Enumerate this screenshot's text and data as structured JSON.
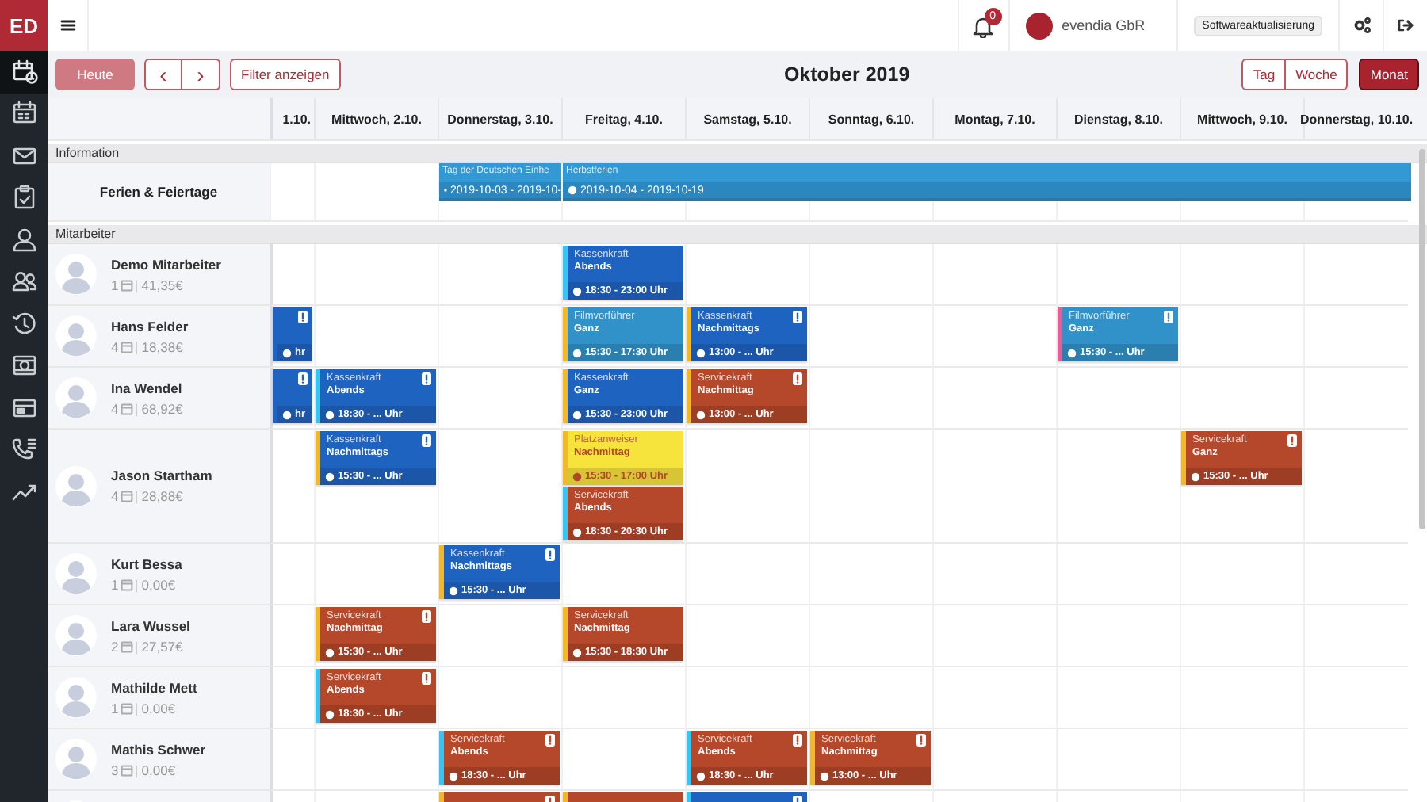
{
  "app": {
    "logo": "ED"
  },
  "sidebar": {
    "items": [
      {
        "kind": "calendar-clock",
        "selected": true
      },
      {
        "kind": "calendar",
        "selected": false
      },
      {
        "kind": "mail",
        "selected": false
      },
      {
        "kind": "clipboard",
        "selected": false
      },
      {
        "kind": "user",
        "selected": false
      },
      {
        "kind": "users",
        "selected": false
      },
      {
        "kind": "history",
        "selected": false
      },
      {
        "kind": "cash",
        "selected": false
      },
      {
        "kind": "card",
        "selected": false
      },
      {
        "kind": "phone",
        "selected": false
      },
      {
        "kind": "chart",
        "selected": false
      }
    ]
  },
  "topbar": {
    "notifications": "0",
    "company": "evendia GbR",
    "update_label": "Softwareaktualisierung"
  },
  "toolbar": {
    "today": "Heute",
    "today_disabled": true,
    "prev": "‹",
    "next": "›",
    "filter": "Filter anzeigen",
    "title": "Oktober 2019",
    "views": [
      {
        "label": "Tag",
        "selected": false
      },
      {
        "label": "Woche",
        "selected": false
      },
      {
        "label": "Monat",
        "selected": true
      }
    ]
  },
  "days": [
    "1.10.",
    "Mittwoch, 2.10.",
    "Donnerstag, 3.10.",
    "Freitag, 4.10.",
    "Samstag, 5.10.",
    "Sonntag, 6.10.",
    "Montag, 7.10.",
    "Dienstag, 8.10.",
    "Mittwoch, 9.10.",
    "Donnerstag, 10.10."
  ],
  "information": {
    "label": "Information",
    "row_label": "Ferien & Feiertage",
    "cells": [
      {},
      {},
      {
        "title": "Tag der Deutschen Einhe",
        "dates": "2019-10-03 - 2019-10-",
        "continues": false
      },
      {
        "title": "Herbstferien",
        "dates": "2019-10-04 - 2019-10-19",
        "continues": true
      },
      {},
      {},
      {},
      {},
      {},
      {}
    ]
  },
  "employees_label": "Mitarbeiter",
  "employees": [
    {
      "name": "Demo Mitarbeiter",
      "days": "1",
      "cost": "| 41,35€",
      "cells": [
        {},
        {},
        {},
        {
          "shifts": [
            {
              "role": "Kassenkraft",
              "part": "Abends",
              "time": "18:30 - 23:00 Uhr",
              "color": "#1f63c1",
              "stripe": {
                "color": "#38c4f0"
              },
              "warning": false
            }
          ]
        },
        {},
        {},
        {},
        {},
        {},
        {}
      ]
    },
    {
      "name": "Hans Felder",
      "days": "4",
      "cost": "| 18,38€",
      "cells": [
        {
          "shifts": [
            {
              "time": "hr",
              "color": "#1f63c1",
              "stripe": {
                "color": "#1f63c1"
              },
              "warning": true
            }
          ]
        },
        {},
        {},
        {
          "shifts": [
            {
              "role": "Filmvorführer",
              "part": "Ganz",
              "time": "15:30 - 17:30 Uhr",
              "color": "#3192c9",
              "stripe": {
                "color": "#f0b82a"
              },
              "warning": false
            }
          ]
        },
        {
          "shifts": [
            {
              "role": "Kassenkraft",
              "part": "Nachmittags",
              "time": "13:00 - ... Uhr",
              "color": "#1f63c1",
              "stripe": {
                "color": "#f0b82a"
              },
              "warning": true
            }
          ]
        },
        {},
        {},
        {
          "shifts": [
            {
              "role": "Filmvorführer",
              "part": "Ganz",
              "time": "15:30 - ... Uhr",
              "color": "#3192c9",
              "stripe": {
                "color": "#e2609a"
              },
              "warning": true
            }
          ]
        },
        {},
        {}
      ]
    },
    {
      "name": "Ina Wendel",
      "days": "4",
      "cost": "| 68,92€",
      "cells": [
        {
          "shifts": [
            {
              "time": "hr",
              "color": "#1f63c1",
              "stripe": {
                "color": "#1f63c1"
              },
              "warning": true
            }
          ]
        },
        {
          "shifts": [
            {
              "role": "Kassenkraft",
              "part": "Abends",
              "time": "18:30 - ... Uhr",
              "color": "#1f63c1",
              "stripe": {
                "color": "#38c4f0"
              },
              "warning": true
            }
          ]
        },
        {},
        {
          "shifts": [
            {
              "role": "Kassenkraft",
              "part": "Ganz",
              "time": "15:30 - 23:00 Uhr",
              "color": "#1f63c1",
              "stripe": {
                "color": "#f0b82a"
              },
              "warning": false
            }
          ]
        },
        {
          "shifts": [
            {
              "role": "Servicekraft",
              "part": "Nachmittag",
              "time": "13:00 - ... Uhr",
              "color": "#b5482a",
              "stripe": {
                "color": "#f0b82a"
              },
              "warning": true
            }
          ]
        },
        {},
        {},
        {},
        {},
        {}
      ]
    },
    {
      "name": "Jason Startham",
      "days": "4",
      "cost": "| 28,88€",
      "cells": [
        {},
        {
          "shifts": [
            {
              "role": "Kassenkraft",
              "part": "Nachmittags",
              "time": "15:30 - ... Uhr",
              "color": "#1f63c1",
              "stripe": {
                "color": "#f0b82a"
              },
              "warning": true
            }
          ]
        },
        {},
        {
          "shifts": [
            {
              "role": "Platzanweiser",
              "part": "Nachmittag",
              "time": "15:30 - 17:00 Uhr",
              "color": "#f6e33c",
              "stripe": {
                "color": "#f0b82a"
              },
              "warning": false
            },
            {
              "role": "Servicekraft",
              "part": "Abends",
              "time": "18:30 - 20:30 Uhr",
              "color": "#b5482a",
              "stripe": {
                "color": "#38c4f0"
              },
              "warning": false
            }
          ]
        },
        {},
        {},
        {},
        {},
        {
          "shifts": [
            {
              "role": "Servicekraft",
              "part": "Ganz",
              "time": "15:30 - ... Uhr",
              "color": "#b5482a",
              "stripe": {
                "color": "#f0b82a"
              },
              "warning": true
            }
          ]
        },
        {}
      ]
    },
    {
      "name": "Kurt Bessa",
      "days": "1",
      "cost": "| 0,00€",
      "cells": [
        {},
        {},
        {
          "shifts": [
            {
              "role": "Kassenkraft",
              "part": "Nachmittags",
              "time": "15:30 - ... Uhr",
              "color": "#1f63c1",
              "stripe": {
                "color": "#f0b82a"
              },
              "warning": true
            }
          ]
        },
        {},
        {},
        {},
        {},
        {},
        {},
        {}
      ]
    },
    {
      "name": "Lara Wussel",
      "days": "2",
      "cost": "| 27,57€",
      "cells": [
        {},
        {
          "shifts": [
            {
              "role": "Servicekraft",
              "part": "Nachmittag",
              "time": "15:30 - ... Uhr",
              "color": "#b5482a",
              "stripe": {
                "color": "#f0b82a"
              },
              "warning": true
            }
          ]
        },
        {},
        {
          "shifts": [
            {
              "role": "Servicekraft",
              "part": "Nachmittag",
              "time": "15:30 - 18:30 Uhr",
              "color": "#b5482a",
              "stripe": {
                "color": "#f0b82a"
              },
              "warning": false
            }
          ]
        },
        {},
        {},
        {},
        {},
        {},
        {}
      ]
    },
    {
      "name": "Mathilde Mett",
      "days": "1",
      "cost": "| 0,00€",
      "cells": [
        {},
        {
          "shifts": [
            {
              "role": "Servicekraft",
              "part": "Abends",
              "time": "18:30 - ... Uhr",
              "color": "#b5482a",
              "stripe": {
                "color": "#38c4f0"
              },
              "warning": true
            }
          ]
        },
        {},
        {},
        {},
        {},
        {},
        {},
        {},
        {}
      ]
    },
    {
      "name": "Mathis Schwer",
      "days": "3",
      "cost": "| 0,00€",
      "cells": [
        {},
        {},
        {
          "shifts": [
            {
              "role": "Servicekraft",
              "part": "Abends",
              "time": "18:30 - ... Uhr",
              "color": "#b5482a",
              "stripe": {
                "color": "#38c4f0"
              },
              "warning": true
            }
          ]
        },
        {},
        {
          "shifts": [
            {
              "role": "Servicekraft",
              "part": "Abends",
              "time": "18:30 - ... Uhr",
              "color": "#b5482a",
              "stripe": {
                "color": "#38c4f0"
              },
              "warning": true
            }
          ]
        },
        {
          "shifts": [
            {
              "role": "Servicekraft",
              "part": "Nachmittag",
              "time": "13:00 - ... Uhr",
              "color": "#b5482a",
              "stripe": {
                "color": "#f0b82a"
              },
              "warning": true
            }
          ]
        },
        {},
        {},
        {},
        {}
      ]
    },
    {
      "cells": [
        {},
        {},
        {
          "shifts": [
            {
              "color": "#b5482a",
              "stripe": {
                "color": "#f0b82a"
              },
              "warning": true
            }
          ]
        },
        {
          "shifts": [
            {
              "color": "#b5482a",
              "stripe": {
                "color": "#f0b82a"
              },
              "warning": false
            }
          ]
        },
        {
          "shifts": [
            {
              "color": "#1f63c1",
              "stripe": {
                "color": "#38c4f0"
              },
              "warning": true
            }
          ]
        },
        {},
        {},
        {},
        {},
        {}
      ]
    }
  ]
}
